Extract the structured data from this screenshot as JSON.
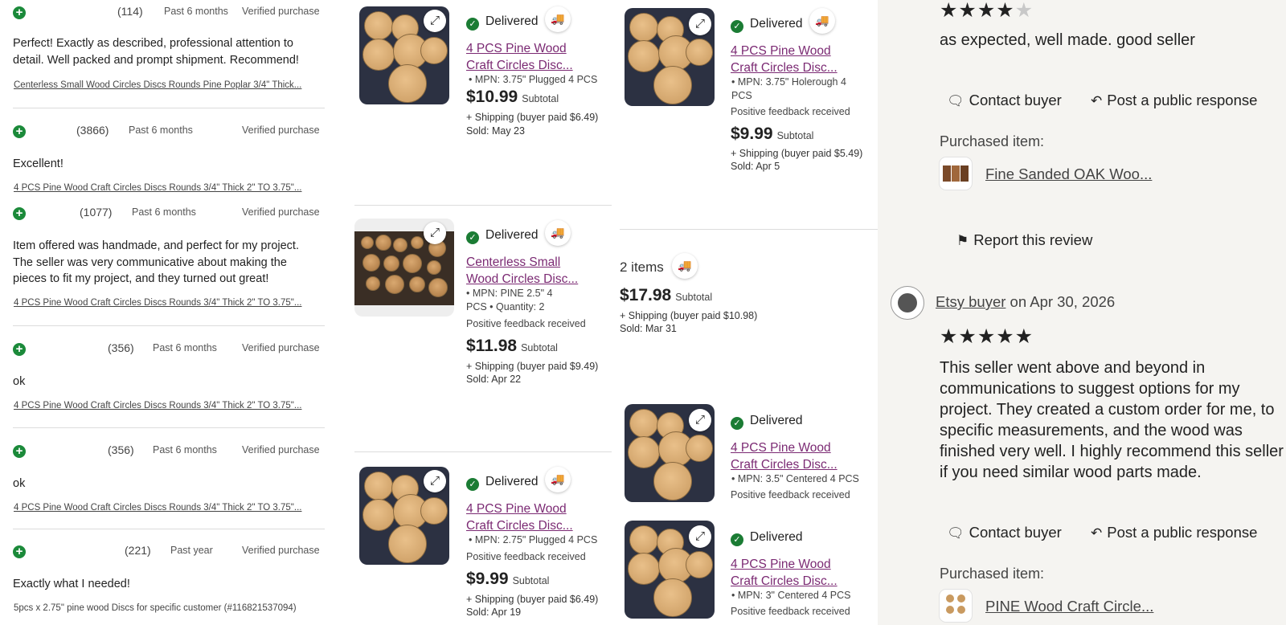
{
  "feedback_list": [
    {
      "count": "(114)",
      "period": "Past 6 months",
      "verified": "Verified purchase",
      "text": "Perfect! Exactly as described, professional attention to detail. Well packed and prompt shipment. Recommend!",
      "item": "Centerless Small Wood Circles Discs Rounds Pine Poplar 3/4\" Thick..."
    },
    {
      "count": "(3866)",
      "period": "Past 6 months",
      "verified": "Verified purchase",
      "text": "Excellent!",
      "item": "4 PCS Pine Wood Craft Circles Discs Rounds 3/4\" Thick 2\" TO 3.75\"..."
    },
    {
      "count": "(1077)",
      "period": "Past 6 months",
      "verified": "Verified purchase",
      "text": "Item offered was handmade, and perfect for my project. The seller was very communicative about making the pieces to fit my project, and they turned out great!",
      "item": "4 PCS Pine Wood Craft Circles Discs Rounds 3/4\" Thick 2\" TO 3.75\"..."
    },
    {
      "count": "(356)",
      "period": "Past 6 months",
      "verified": "Verified purchase",
      "text": "ok",
      "item": "4 PCS Pine Wood Craft Circles Discs Rounds 3/4\" Thick 2\" TO 3.75\"..."
    },
    {
      "count": "(356)",
      "period": "Past 6 months",
      "verified": "Verified purchase",
      "text": "ok",
      "item": "4 PCS Pine Wood Craft Circles Discs Rounds 3/4\" Thick 2\" TO 3.75\"..."
    },
    {
      "count": "(221)",
      "period": "Past year",
      "verified": "Verified purchase",
      "text": "Exactly what I needed!",
      "item": "5pcs x 2.75\" pine wood Discs for specific customer (#116821537094)"
    }
  ],
  "orders": {
    "a": {
      "status": "Delivered",
      "title": "4 PCS Pine Wood Craft Circles Disc...",
      "mpn": "MPN: 3.75\" Plugged 4 PCS",
      "price": "$10.99",
      "subtotal": "Subtotal",
      "shipping": "+ Shipping (buyer paid $6.49)",
      "sold": "Sold: May 23"
    },
    "b": {
      "status": "Delivered",
      "title": "4 PCS Pine Wood Craft Circles Disc...",
      "mpn": "MPN: 3.75\" Holerough 4 PCS",
      "feedback": "Positive feedback received",
      "price": "$9.99",
      "subtotal": "Subtotal",
      "shipping": "+ Shipping (buyer paid $5.49)",
      "sold": "Sold: Apr 5"
    },
    "c": {
      "status": "Delivered",
      "title": "Centerless Small Wood Circles Disc...",
      "mpn": "MPN: PINE 2.5\" 4 PCS",
      "qty": "Quantity: 2",
      "feedback": "Positive feedback received",
      "price": "$11.98",
      "subtotal": "Subtotal",
      "shipping": "+ Shipping (buyer paid $9.49)",
      "sold": "Sold: Apr 22"
    },
    "multi": {
      "items": "2 items",
      "price": "$17.98",
      "subtotal": "Subtotal",
      "shipping": "+ Shipping (buyer paid $10.98)",
      "sold": "Sold: Mar 31"
    },
    "d": {
      "status": "Delivered",
      "title": "4 PCS Pine Wood Craft Circles Disc...",
      "mpn": "MPN: 2.75\" Plugged 4 PCS",
      "feedback": "Positive feedback received",
      "price": "$9.99",
      "subtotal": "Subtotal",
      "shipping": "+ Shipping (buyer paid $6.49)",
      "sold": "Sold: Apr 19"
    },
    "e": {
      "status": "Delivered",
      "title": "4 PCS Pine Wood Craft Circles Disc...",
      "mpn": "MPN: 3.5\" Centered 4 PCS",
      "feedback": "Positive feedback received"
    },
    "f": {
      "status": "Delivered",
      "title": "4 PCS Pine Wood Craft Circles Disc...",
      "mpn": "MPN: 3\" Centered 4 PCS",
      "feedback": "Positive feedback received"
    }
  },
  "review_panel": {
    "review1": {
      "rating": 4,
      "text": "as expected, well made. good seller",
      "contact": "Contact buyer",
      "respond": "Post a public response",
      "purchased_label": "Purchased item:",
      "item": "Fine Sanded OAK Woo...",
      "report": "Report this review"
    },
    "review2": {
      "buyer": "Etsy buyer",
      "on": "on",
      "date": "Apr 30, 2026",
      "rating": 5,
      "text": "This seller went above and beyond in communications to suggest options for my project. They created a custom order for me, to specific measurements, and the wood was finished very well. I highly recommend this seller if you need similar wood parts made.",
      "contact": "Contact buyer",
      "respond": "Post a public response",
      "purchased_label": "Purchased item:",
      "item": "PINE Wood Craft Circle..."
    }
  },
  "icons": {
    "positive": "plus-circle-icon",
    "expand": "expand-arrows-icon",
    "delivered": "check-circle-icon",
    "truck": "truck-icon",
    "message": "message-icon",
    "reply": "reply-arrow-icon",
    "flag": "flag-icon"
  },
  "colors": {
    "positive": "#1b8a3a",
    "link": "#7b2a73",
    "panel": "#f5f4f1"
  }
}
